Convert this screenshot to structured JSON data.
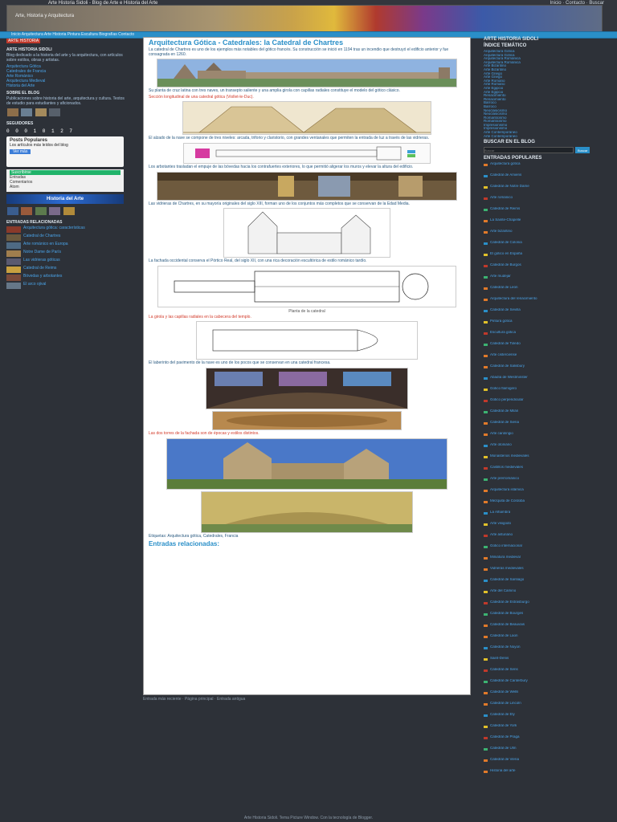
{
  "header": {
    "title": "Arte Historia Sidoli - Blog de Arte e Historia del Arte",
    "links": "Inicio · Contacto · Buscar",
    "tagline": "Arte, Historia y Arquitectura"
  },
  "nav": {
    "links": "Inicio  Arquitectura  Arte  Historia  Pintura  Escultura  Biografías  Contacto"
  },
  "left": {
    "badge": "ARTE HISTORIA",
    "intro_heading": "ARTE HISTORIA SIDOLI",
    "intro_text": "Blog dedicado a la historia del arte y la arquitectura, con artículos sobre estilos, obras y artistas.",
    "links": [
      "Arquitectura Gótica",
      "Catedrales de Francia",
      "Arte Románico",
      "Arquitectura Medieval",
      "Historia del Arte"
    ],
    "about_heading": "SOBRE EL BLOG",
    "about_text": "Publicaciones sobre historia del arte, arquitectura y cultura. Textos de estudio para estudiantes y aficionados.",
    "follow_heading": "SEGUIDORES",
    "counter": "0 0 0 1 0 1 2 7",
    "widget_title": "Posts Populares",
    "widget_text": "Los artículos más leídos del blog",
    "widget_button": "Ver más",
    "green_bar": "Suscribirse",
    "green_items": [
      "Entradas",
      "Comentarios",
      "Atom"
    ],
    "banner_text": "Historia del Arte",
    "related_heading": "ENTRADAS RELACIONADAS",
    "related": [
      "Arquitectura gótica: características",
      "Catedral de Chartres",
      "Arte románico en Europa",
      "Notre Dame de París",
      "Las vidrieras góticas",
      "Catedral de Reims",
      "Bóvedas y arbotantes",
      "El arco ojival"
    ]
  },
  "article": {
    "title": "Arquitectura Gótica - Catedrales: la Catedral de Chartres",
    "p1": "La catedral de Chartres es uno de los ejemplos más notables del gótico francés. Su construcción se inició en 1194 tras un incendio que destruyó el edificio anterior y fue consagrada en 1260.",
    "p2": "Su planta de cruz latina con tres naves, un transepto saliente y una amplia girola con capillas radiales constituye el modelo del gótico clásico.",
    "red1": "Sección longitudinal de una catedral gótica (Viollet-le-Duc).",
    "p3": "El alzado de la nave se compone de tres niveles: arcada, triforio y claristorio, con grandes ventanales que permiten la entrada de luz a través de las vidrieras.",
    "p4": "Los arbotantes trasladan el empuje de las bóvedas hacia los contrafuertes exteriores, lo que permitió aligerar los muros y elevar la altura del edificio.",
    "caption1": "Planta de la catedral",
    "red2": "La girola y las capillas radiales en la cabecera del templo.",
    "p5": "Las vidrieras de Chartres, en su mayoría originales del siglo XIII, forman uno de los conjuntos más completos que se conservan de la Edad Media.",
    "p6": "La fachada occidental conserva el Pórtico Real, del siglo XII, con una rica decoración escultórica de estilo románico tardío.",
    "red3": "Las dos torres de la fachada son de épocas y estilos distintos.",
    "p7": "El laberinto del pavimento de la nave es uno de los pocos que se conservan en una catedral francesa.",
    "tags": "Etiquetas: Arquitectura gótica, Catedrales, Francia",
    "related_title": "Entradas relacionadas:"
  },
  "below_article": "Entrada más reciente · Página principal · Entrada antigua",
  "footer": "Arte Historia Sidoli. Tema Picture Window. Con la tecnología de Blogger.",
  "right": {
    "top_heading": "ARTE HISTORIA SIDOLI",
    "index_heading": "ÍNDICE TEMÁTICO",
    "index_links": [
      "Arquitectura Gótica",
      "Arquitectura Románica",
      "Arte Bizantino",
      "Arte Griego",
      "Arte Romano",
      "Arte Egipcio",
      "Renacimiento",
      "Barroco",
      "Neoclasicismo",
      "Romanticismo",
      "Impresionismo",
      "Arte Contemporáneo"
    ],
    "search_heading": "BUSCAR EN EL BLOG",
    "search_placeholder": "Buscar",
    "search_button": "Buscar",
    "posts_heading": "ENTRADAS POPULARES",
    "posts": [
      "Arquitectura gótica",
      "Catedral de Amiens",
      "Catedral de Notre Dame",
      "Arte románico",
      "Catedral de Reims",
      "La Sainte-Chapelle",
      "Arte bizantino",
      "Catedral de Colonia",
      "El gótico en España",
      "Catedral de Burgos",
      "Arte mudéjar",
      "Catedral de León",
      "Arquitectura del renacimiento",
      "Catedral de Sevilla",
      "Pintura gótica",
      "Escultura gótica",
      "Catedral de Toledo",
      "Arte cisterciense",
      "Catedral de Salisbury",
      "Abadía de Westminster",
      "Gótico flamígero",
      "Gótico perpendicular",
      "Catedral de Milán",
      "Catedral de Siena",
      "Arte carolingio",
      "Arte otoniano",
      "Monasterios medievales",
      "Castillos medievales",
      "Arte prerrománico",
      "Arquitectura islámica",
      "Mezquita de Córdoba",
      "La Alhambra",
      "Arte visigodo",
      "Arte asturiano",
      "Gótico internacional",
      "Miniatura medieval",
      "Vidrieras medievales",
      "Catedral de Santiago",
      "Arte del Camino",
      "Catedral de Estrasburgo",
      "Catedral de Bourges",
      "Catedral de Beauvais",
      "Catedral de Laon",
      "Catedral de Noyon",
      "Saint-Denis",
      "Catedral de Sens",
      "Catedral de Canterbury",
      "Catedral de Wells",
      "Catedral de Lincoln",
      "Catedral de Ely",
      "Catedral de York",
      "Catedral de Praga",
      "Catedral de Ulm",
      "Catedral de Viena",
      "Historia del arte"
    ]
  },
  "colors": {
    "background": "#2d3138",
    "accent_blue": "#2a8fc8",
    "link_blue": "#4aa3e8",
    "red": "#c0392b",
    "bullet_orange": "#e07a2a"
  }
}
